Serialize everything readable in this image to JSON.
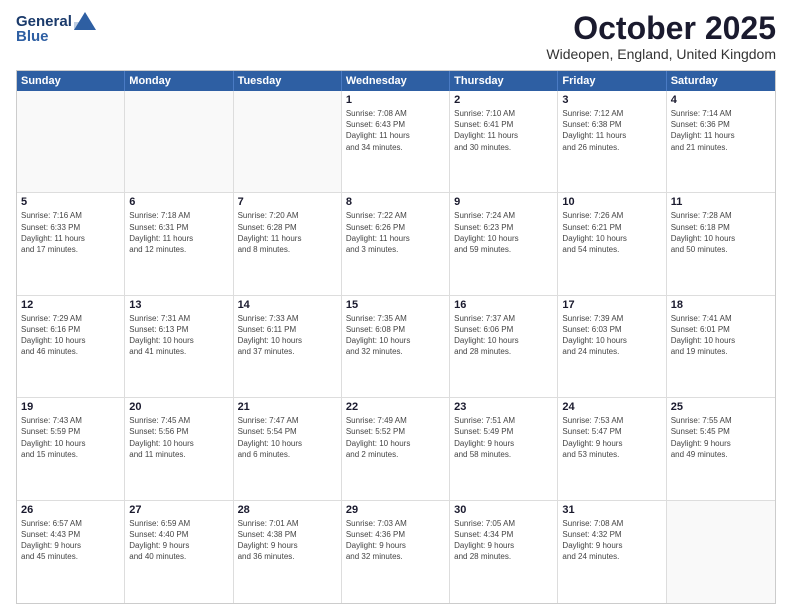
{
  "header": {
    "logo": {
      "line1": "General",
      "line2": "Blue"
    },
    "title": "October 2025",
    "location": "Wideopen, England, United Kingdom"
  },
  "weekdays": [
    "Sunday",
    "Monday",
    "Tuesday",
    "Wednesday",
    "Thursday",
    "Friday",
    "Saturday"
  ],
  "weeks": [
    [
      {
        "day": "",
        "info": ""
      },
      {
        "day": "",
        "info": ""
      },
      {
        "day": "",
        "info": ""
      },
      {
        "day": "1",
        "info": "Sunrise: 7:08 AM\nSunset: 6:43 PM\nDaylight: 11 hours\nand 34 minutes."
      },
      {
        "day": "2",
        "info": "Sunrise: 7:10 AM\nSunset: 6:41 PM\nDaylight: 11 hours\nand 30 minutes."
      },
      {
        "day": "3",
        "info": "Sunrise: 7:12 AM\nSunset: 6:38 PM\nDaylight: 11 hours\nand 26 minutes."
      },
      {
        "day": "4",
        "info": "Sunrise: 7:14 AM\nSunset: 6:36 PM\nDaylight: 11 hours\nand 21 minutes."
      }
    ],
    [
      {
        "day": "5",
        "info": "Sunrise: 7:16 AM\nSunset: 6:33 PM\nDaylight: 11 hours\nand 17 minutes."
      },
      {
        "day": "6",
        "info": "Sunrise: 7:18 AM\nSunset: 6:31 PM\nDaylight: 11 hours\nand 12 minutes."
      },
      {
        "day": "7",
        "info": "Sunrise: 7:20 AM\nSunset: 6:28 PM\nDaylight: 11 hours\nand 8 minutes."
      },
      {
        "day": "8",
        "info": "Sunrise: 7:22 AM\nSunset: 6:26 PM\nDaylight: 11 hours\nand 3 minutes."
      },
      {
        "day": "9",
        "info": "Sunrise: 7:24 AM\nSunset: 6:23 PM\nDaylight: 10 hours\nand 59 minutes."
      },
      {
        "day": "10",
        "info": "Sunrise: 7:26 AM\nSunset: 6:21 PM\nDaylight: 10 hours\nand 54 minutes."
      },
      {
        "day": "11",
        "info": "Sunrise: 7:28 AM\nSunset: 6:18 PM\nDaylight: 10 hours\nand 50 minutes."
      }
    ],
    [
      {
        "day": "12",
        "info": "Sunrise: 7:29 AM\nSunset: 6:16 PM\nDaylight: 10 hours\nand 46 minutes."
      },
      {
        "day": "13",
        "info": "Sunrise: 7:31 AM\nSunset: 6:13 PM\nDaylight: 10 hours\nand 41 minutes."
      },
      {
        "day": "14",
        "info": "Sunrise: 7:33 AM\nSunset: 6:11 PM\nDaylight: 10 hours\nand 37 minutes."
      },
      {
        "day": "15",
        "info": "Sunrise: 7:35 AM\nSunset: 6:08 PM\nDaylight: 10 hours\nand 32 minutes."
      },
      {
        "day": "16",
        "info": "Sunrise: 7:37 AM\nSunset: 6:06 PM\nDaylight: 10 hours\nand 28 minutes."
      },
      {
        "day": "17",
        "info": "Sunrise: 7:39 AM\nSunset: 6:03 PM\nDaylight: 10 hours\nand 24 minutes."
      },
      {
        "day": "18",
        "info": "Sunrise: 7:41 AM\nSunset: 6:01 PM\nDaylight: 10 hours\nand 19 minutes."
      }
    ],
    [
      {
        "day": "19",
        "info": "Sunrise: 7:43 AM\nSunset: 5:59 PM\nDaylight: 10 hours\nand 15 minutes."
      },
      {
        "day": "20",
        "info": "Sunrise: 7:45 AM\nSunset: 5:56 PM\nDaylight: 10 hours\nand 11 minutes."
      },
      {
        "day": "21",
        "info": "Sunrise: 7:47 AM\nSunset: 5:54 PM\nDaylight: 10 hours\nand 6 minutes."
      },
      {
        "day": "22",
        "info": "Sunrise: 7:49 AM\nSunset: 5:52 PM\nDaylight: 10 hours\nand 2 minutes."
      },
      {
        "day": "23",
        "info": "Sunrise: 7:51 AM\nSunset: 5:49 PM\nDaylight: 9 hours\nand 58 minutes."
      },
      {
        "day": "24",
        "info": "Sunrise: 7:53 AM\nSunset: 5:47 PM\nDaylight: 9 hours\nand 53 minutes."
      },
      {
        "day": "25",
        "info": "Sunrise: 7:55 AM\nSunset: 5:45 PM\nDaylight: 9 hours\nand 49 minutes."
      }
    ],
    [
      {
        "day": "26",
        "info": "Sunrise: 6:57 AM\nSunset: 4:43 PM\nDaylight: 9 hours\nand 45 minutes."
      },
      {
        "day": "27",
        "info": "Sunrise: 6:59 AM\nSunset: 4:40 PM\nDaylight: 9 hours\nand 40 minutes."
      },
      {
        "day": "28",
        "info": "Sunrise: 7:01 AM\nSunset: 4:38 PM\nDaylight: 9 hours\nand 36 minutes."
      },
      {
        "day": "29",
        "info": "Sunrise: 7:03 AM\nSunset: 4:36 PM\nDaylight: 9 hours\nand 32 minutes."
      },
      {
        "day": "30",
        "info": "Sunrise: 7:05 AM\nSunset: 4:34 PM\nDaylight: 9 hours\nand 28 minutes."
      },
      {
        "day": "31",
        "info": "Sunrise: 7:08 AM\nSunset: 4:32 PM\nDaylight: 9 hours\nand 24 minutes."
      },
      {
        "day": "",
        "info": ""
      }
    ]
  ]
}
